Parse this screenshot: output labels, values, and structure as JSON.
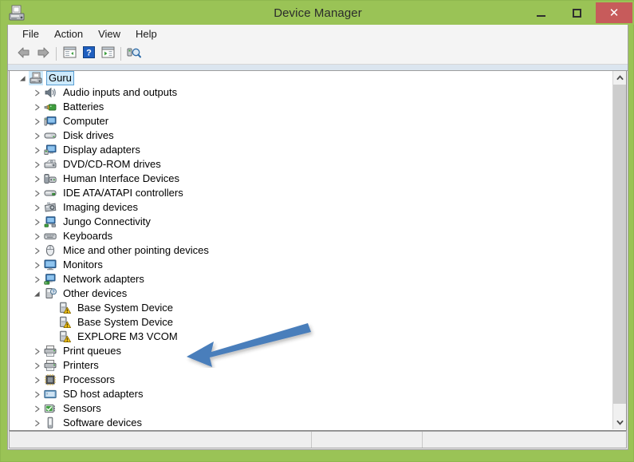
{
  "window": {
    "title": "Device Manager",
    "app_icon": "device-manager-icon",
    "frame_color": "#9ac356",
    "close_button_color": "#c75b5b",
    "controls": {
      "minimize": "–",
      "maximize": "□",
      "close": "✕"
    }
  },
  "menubar": {
    "items": [
      {
        "label": "File"
      },
      {
        "label": "Action"
      },
      {
        "label": "View"
      },
      {
        "label": "Help"
      }
    ]
  },
  "toolbar": {
    "buttons": [
      {
        "name": "back-arrow-icon",
        "type": "icon"
      },
      {
        "name": "forward-arrow-icon",
        "type": "icon"
      },
      {
        "name": "separator",
        "type": "separator"
      },
      {
        "name": "show-hide-console-tree-icon",
        "type": "icon"
      },
      {
        "name": "help-icon",
        "type": "icon"
      },
      {
        "name": "properties-icon",
        "type": "icon"
      },
      {
        "name": "separator",
        "type": "separator"
      },
      {
        "name": "scan-for-hardware-changes-icon",
        "type": "icon"
      }
    ]
  },
  "tree": {
    "selection_fill": "#cdeafc",
    "selection_border": "#5a9fd4",
    "nodes": [
      {
        "label": "Guru",
        "depth": 0,
        "state": "expanded",
        "icon": "computer-tower-icon",
        "selected": true
      },
      {
        "label": "Audio inputs and outputs",
        "depth": 1,
        "state": "collapsed",
        "icon": "speaker-icon",
        "selected": false
      },
      {
        "label": "Batteries",
        "depth": 1,
        "state": "collapsed",
        "icon": "battery-icon",
        "selected": false
      },
      {
        "label": "Computer",
        "depth": 1,
        "state": "collapsed",
        "icon": "computer-icon",
        "selected": false
      },
      {
        "label": "Disk drives",
        "depth": 1,
        "state": "collapsed",
        "icon": "disk-drive-icon",
        "selected": false
      },
      {
        "label": "Display adapters",
        "depth": 1,
        "state": "collapsed",
        "icon": "display-adapter-icon",
        "selected": false
      },
      {
        "label": "DVD/CD-ROM drives",
        "depth": 1,
        "state": "collapsed",
        "icon": "dvd-drive-icon",
        "selected": false
      },
      {
        "label": "Human Interface Devices",
        "depth": 1,
        "state": "collapsed",
        "icon": "hid-gamepad-icon",
        "selected": false
      },
      {
        "label": "IDE ATA/ATAPI controllers",
        "depth": 1,
        "state": "collapsed",
        "icon": "ide-controller-icon",
        "selected": false
      },
      {
        "label": "Imaging devices",
        "depth": 1,
        "state": "collapsed",
        "icon": "camera-icon",
        "selected": false
      },
      {
        "label": "Jungo Connectivity",
        "depth": 1,
        "state": "collapsed",
        "icon": "network-device-icon",
        "selected": false
      },
      {
        "label": "Keyboards",
        "depth": 1,
        "state": "collapsed",
        "icon": "keyboard-icon",
        "selected": false
      },
      {
        "label": "Mice and other pointing devices",
        "depth": 1,
        "state": "collapsed",
        "icon": "mouse-icon",
        "selected": false
      },
      {
        "label": "Monitors",
        "depth": 1,
        "state": "collapsed",
        "icon": "monitor-icon",
        "selected": false
      },
      {
        "label": "Network adapters",
        "depth": 1,
        "state": "collapsed",
        "icon": "network-adapter-icon",
        "selected": false
      },
      {
        "label": "Other devices",
        "depth": 1,
        "state": "expanded",
        "icon": "other-devices-icon",
        "selected": false
      },
      {
        "label": "Base System Device",
        "depth": 2,
        "state": "leaf",
        "icon": "warning-device-icon",
        "selected": false
      },
      {
        "label": "Base System Device",
        "depth": 2,
        "state": "leaf",
        "icon": "warning-device-icon",
        "selected": false
      },
      {
        "label": "EXPLORE M3 VCOM",
        "depth": 2,
        "state": "leaf",
        "icon": "warning-device-icon",
        "selected": false
      },
      {
        "label": "Print queues",
        "depth": 1,
        "state": "collapsed",
        "icon": "printer-icon",
        "selected": false
      },
      {
        "label": "Printers",
        "depth": 1,
        "state": "collapsed",
        "icon": "printer-icon",
        "selected": false
      },
      {
        "label": "Processors",
        "depth": 1,
        "state": "collapsed",
        "icon": "processor-icon",
        "selected": false
      },
      {
        "label": "SD host adapters",
        "depth": 1,
        "state": "collapsed",
        "icon": "sd-host-adapter-icon",
        "selected": false
      },
      {
        "label": "Sensors",
        "depth": 1,
        "state": "collapsed",
        "icon": "sensor-icon",
        "selected": false
      },
      {
        "label": "Software devices",
        "depth": 1,
        "state": "collapsed",
        "icon": "software-device-icon",
        "selected": false
      }
    ]
  },
  "scrollbar": {
    "up_arrow": "▲",
    "down_arrow": "▼",
    "orientation": "vertical"
  },
  "statusbar": {
    "panes": [
      "",
      "",
      ""
    ]
  },
  "annotation": {
    "type": "arrow",
    "color": "#4a7ebb",
    "points_to": "EXPLORE M3 VCOM",
    "direction": "left"
  }
}
